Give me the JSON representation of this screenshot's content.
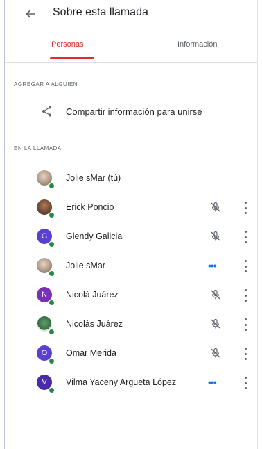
{
  "header": {
    "title": "Sobre esta llamada",
    "back_icon": "arrow-back-icon"
  },
  "tabs": [
    {
      "label": "Personas",
      "active": true
    },
    {
      "label": "Información",
      "active": false
    }
  ],
  "sections": {
    "add": "AGREGAR A ALGUIEN",
    "in_call": "EN LA LLAMADA"
  },
  "share": {
    "label": "Compartir información para unirse",
    "icon": "share-icon"
  },
  "participants": [
    {
      "name": "Jolie sMar (tú)",
      "avatar": "photo",
      "status": "none"
    },
    {
      "name": "Erick Poncio",
      "avatar": "photo",
      "status": "muted"
    },
    {
      "name": "Glendy Galicia",
      "avatar": "G",
      "status": "muted"
    },
    {
      "name": "Jolie sMar",
      "avatar": "photo",
      "status": "speaking"
    },
    {
      "name": "Nicolá Juárez",
      "avatar": "N",
      "status": "muted"
    },
    {
      "name": "Nicolás Juárez",
      "avatar": "photo",
      "status": "muted"
    },
    {
      "name": "Omar Merida",
      "avatar": "O",
      "status": "muted"
    },
    {
      "name": "Vilma Yaceny Argueta López",
      "avatar": "V",
      "status": "speaking"
    }
  ],
  "colors": {
    "accent": "#d93025",
    "online": "#1e8e3e",
    "speaking": "#1a73e8",
    "avatar_purple": "#5b3fd0"
  },
  "speaking_glyph": "•••"
}
